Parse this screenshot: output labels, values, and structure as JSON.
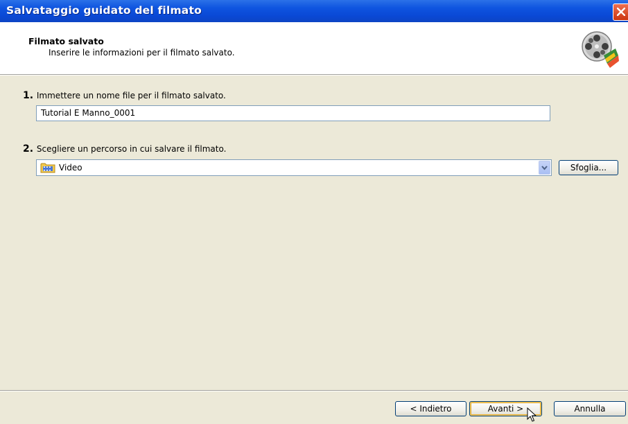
{
  "window": {
    "title": "Salvataggio guidato del filmato"
  },
  "header": {
    "title": "Filmato salvato",
    "subtitle": "Inserire le informazioni per il filmato salvato.",
    "icon": "film-reel-icon"
  },
  "step1": {
    "number": "1.",
    "label": "Immettere un nome file per il filmato salvato.",
    "filename_value": "Tutorial E Manno_0001"
  },
  "step2": {
    "number": "2.",
    "label": "Scegliere un percorso in cui salvare il filmato.",
    "path_value": "Video",
    "path_icon": "video-folder-icon",
    "browse_label": "Sfoglia..."
  },
  "footer": {
    "back_label": "< Indietro",
    "next_label": "Avanti >",
    "cancel_label": "Annulla"
  },
  "colors": {
    "titlebar": "#0a49d6",
    "dialog_bg": "#ece9d8",
    "close": "#cc3511",
    "input_border": "#7f9db9"
  }
}
